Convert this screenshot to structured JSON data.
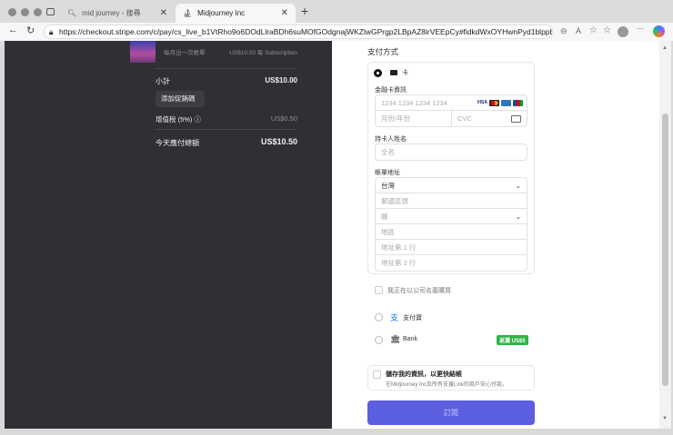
{
  "browser": {
    "tabs": [
      {
        "label": "mid journey - 搜尋"
      },
      {
        "label": "Midjourney Inc"
      }
    ],
    "url": "https://checkout.stripe.com/c/pay/cs_live_b1VtRho9o6DOdLlraBDh6suMOfGOdgnajWKZlwGPrgp2LBpAZ8irVEEpCy#fidkdWxOYHwnPyd1blppbHNg..."
  },
  "summary": {
    "plan_sub": "每月出一次帳單",
    "plan_price_detail": "US$10.00 每 Subscription",
    "subtotal_label": "小計",
    "subtotal_value": "US$10.00",
    "promo_button": "添加促銷碼",
    "tax_label": "增值稅 (5%)",
    "tax_value": "US$0.50",
    "total_label": "今天應付總額",
    "total_value": "US$10.50"
  },
  "payment": {
    "title": "支付方式",
    "card_label": "卡",
    "card_info_label": "金融卡資訊",
    "card_number_placeholder": "1234 1234 1234 1234",
    "expiry_placeholder": "月份/年份",
    "cvc_placeholder": "CVC",
    "brands": [
      "VISA",
      "MC",
      "AMEX",
      "JCB"
    ],
    "name_label": "持卡人姓名",
    "name_placeholder": "全名",
    "address_label": "帳單地址",
    "country": "台灣",
    "postal_placeholder": "郵遞區號",
    "county_placeholder": "縣",
    "district_placeholder": "地區",
    "line1_placeholder": "地址第 1 行",
    "line2_placeholder": "地址第 2 行",
    "business_label": "我正在以公司名義購買",
    "alipay_label": "支付寶",
    "bank_label": "Bank",
    "bank_badge": "返還 US$5",
    "save_title": "儲存我的資訊，以更快結帳",
    "save_desc": "在Midjourney Inc及所有支援Link的商戶安心付款。",
    "subscribe_button": "訂閱",
    "accent": "#5b5fe0",
    "badge_color": "#2fb344"
  }
}
